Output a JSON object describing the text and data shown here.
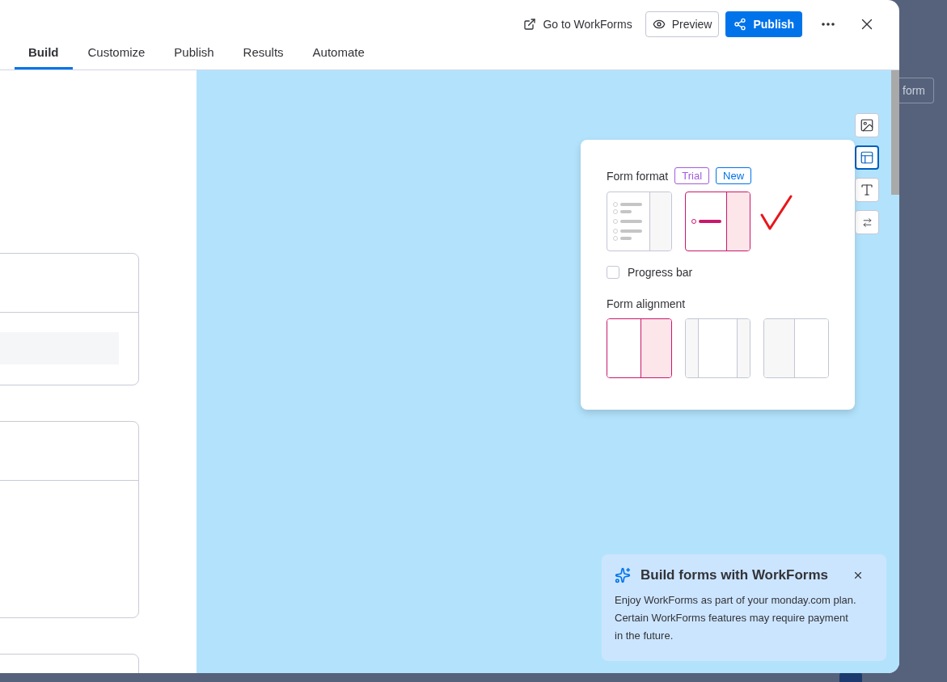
{
  "header": {
    "actions": [
      {
        "kind": "link",
        "label": "Go to WorkForms"
      },
      {
        "kind": "secondary",
        "label": "Preview"
      },
      {
        "kind": "primary",
        "label": "Publish"
      },
      {
        "kind": "more"
      },
      {
        "kind": "close"
      }
    ]
  },
  "tabs": [
    {
      "label": "Build",
      "selected": true
    },
    {
      "label": "Customize",
      "selected": false
    },
    {
      "label": "Publish",
      "selected": false
    },
    {
      "label": "Results",
      "selected": false
    },
    {
      "label": "Automate",
      "selected": false
    }
  ],
  "side_tools": [
    {
      "kind": "image",
      "selected": false
    },
    {
      "kind": "layout",
      "selected": true
    },
    {
      "kind": "text",
      "selected": false
    },
    {
      "kind": "swap",
      "selected": false
    }
  ],
  "format_panel": {
    "title": "Form format",
    "badges": [
      {
        "label": "Trial",
        "color": "#a25ddc"
      },
      {
        "label": "New",
        "color": "#0073ea"
      }
    ],
    "formats": [
      {
        "kind": "list",
        "selected": false
      },
      {
        "kind": "single",
        "selected": true
      }
    ],
    "progress_bar": {
      "label": "Progress bar",
      "checked": false
    },
    "alignment_title": "Form alignment",
    "alignments": [
      {
        "kind": "right-pane",
        "selected": true
      },
      {
        "kind": "center",
        "selected": false
      },
      {
        "kind": "left-pane",
        "selected": false
      }
    ]
  },
  "promo": {
    "title": "Build forms with WorkForms",
    "body": "Enjoy WorkForms as part of your monday.com plan. Certain WorkForms features may require payment in the future."
  },
  "background": {
    "button": "form"
  }
}
